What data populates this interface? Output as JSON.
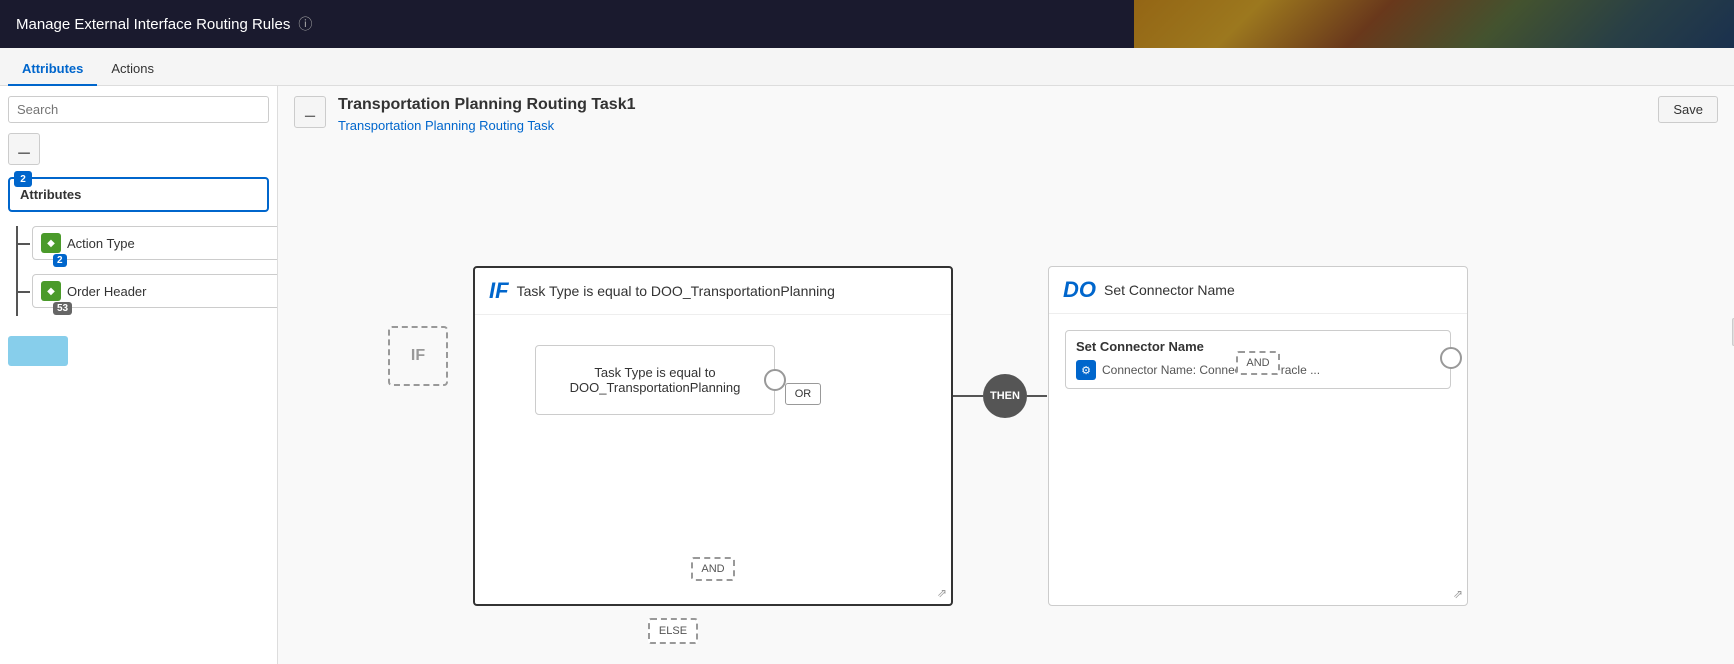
{
  "header": {
    "title": "Manage External Interface Routing Rules",
    "help_icon": "?",
    "save_label": "Save"
  },
  "tabs": [
    {
      "id": "attributes",
      "label": "Attributes",
      "active": true
    },
    {
      "id": "actions",
      "label": "Actions",
      "active": false
    }
  ],
  "sidebar": {
    "search_placeholder": "Search",
    "attributes_label": "Attributes",
    "attributes_badge": "2",
    "items": [
      {
        "label": "Action Type",
        "badge": "2",
        "badge_style": "blue"
      },
      {
        "label": "Order Header",
        "badge": "53",
        "badge_style": "gray"
      }
    ]
  },
  "canvas": {
    "title": "Transportation Planning Routing Task1",
    "subtitle": "Transportation Planning Routing Task",
    "if_keyword": "IF",
    "if_placeholder": "IF",
    "if_condition": "Task Type is equal to DOO_TransportationPlanning",
    "condition_box_text": "Task Type is equal to\nDOO_TransportationPlanning",
    "or_label": "OR",
    "and_label": "AND",
    "then_label": "THEN",
    "else_label": "ELSE",
    "do_keyword": "DO",
    "do_title": "Set Connector Name",
    "set_connector_title": "Set Connector Name",
    "set_connector_detail": "Connector Name: Connector to Oracle ...",
    "and_label2": "AND"
  }
}
